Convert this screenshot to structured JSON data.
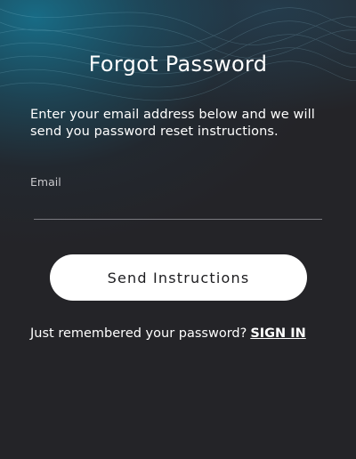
{
  "page": {
    "title": "Forgot Password",
    "description": "Enter your email address below and we will send you password reset instructions."
  },
  "form": {
    "email_label": "Email",
    "email_value": "",
    "send_button_label": "Send Instructions"
  },
  "footer": {
    "prompt_text": "Just remembered your password?",
    "signin_link": "SIGN IN"
  },
  "colors": {
    "background": "#242428",
    "accent_glow": "#16789a",
    "button_background": "#ffffff",
    "text": "#ffffff"
  }
}
